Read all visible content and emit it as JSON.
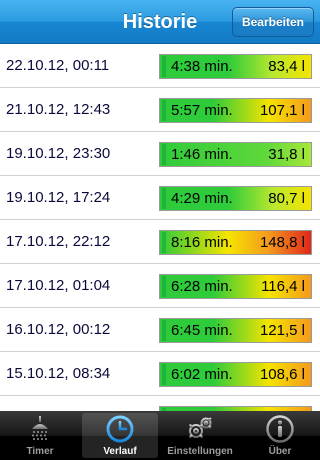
{
  "nav": {
    "title": "Historie",
    "edit_label": "Bearbeiten"
  },
  "history": [
    {
      "date": "22.10.12, 00:11",
      "duration": "4:38 min.",
      "volume": "83,4 l",
      "level": 0.45
    },
    {
      "date": "21.10.12, 12:43",
      "duration": "5:57 min.",
      "volume": "107,1 l",
      "level": 0.62
    },
    {
      "date": "19.10.12, 23:30",
      "duration": "1:46 min.",
      "volume": "31,8 l",
      "level": 0.17
    },
    {
      "date": "19.10.12, 17:24",
      "duration": "4:29 min.",
      "volume": "80,7 l",
      "level": 0.45
    },
    {
      "date": "17.10.12, 22:12",
      "duration": "8:16 min.",
      "volume": "148,8 l",
      "level": 0.9
    },
    {
      "date": "17.10.12, 01:04",
      "duration": "6:28 min.",
      "volume": "116,4 l",
      "level": 0.65
    },
    {
      "date": "16.10.12, 00:12",
      "duration": "6:45 min.",
      "volume": "121,5 l",
      "level": 0.68
    },
    {
      "date": "15.10.12, 08:34",
      "duration": "6:02 min.",
      "volume": "108,6 l",
      "level": 0.62
    },
    {
      "date": "",
      "duration": "",
      "volume": "",
      "level": 0.5
    }
  ],
  "tabs": [
    {
      "label": "Timer",
      "icon": "shower-icon",
      "active": false
    },
    {
      "label": "Verlauf",
      "icon": "clock-icon",
      "active": true
    },
    {
      "label": "Einstellungen",
      "icon": "gears-icon",
      "active": false
    },
    {
      "label": "Über",
      "icon": "info-icon",
      "active": false
    }
  ],
  "colors": {
    "nav_blue": "#1887d3",
    "bar_green": "#2ecb3a",
    "bar_yellow": "#f5e400",
    "bar_orange": "#f49a1e",
    "bar_red": "#e0271c"
  }
}
